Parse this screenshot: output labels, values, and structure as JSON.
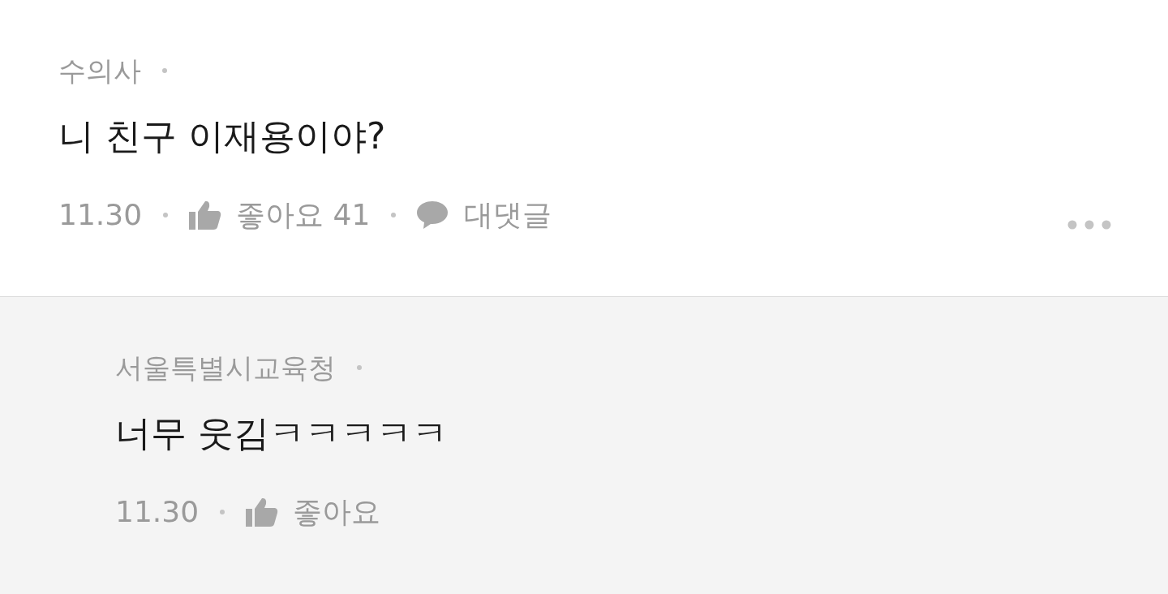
{
  "comments": [
    {
      "author": "수의사",
      "text": "니 친구 이재용이야?",
      "date": "11.30",
      "like_label": "좋아요 41",
      "reply_label": "대댓글",
      "is_reply": false
    },
    {
      "author": "서울특별시교육청",
      "text": "너무 웃김ㅋㅋㅋㅋㅋ",
      "date": "11.30",
      "like_label": "좋아요",
      "is_reply": true
    }
  ]
}
